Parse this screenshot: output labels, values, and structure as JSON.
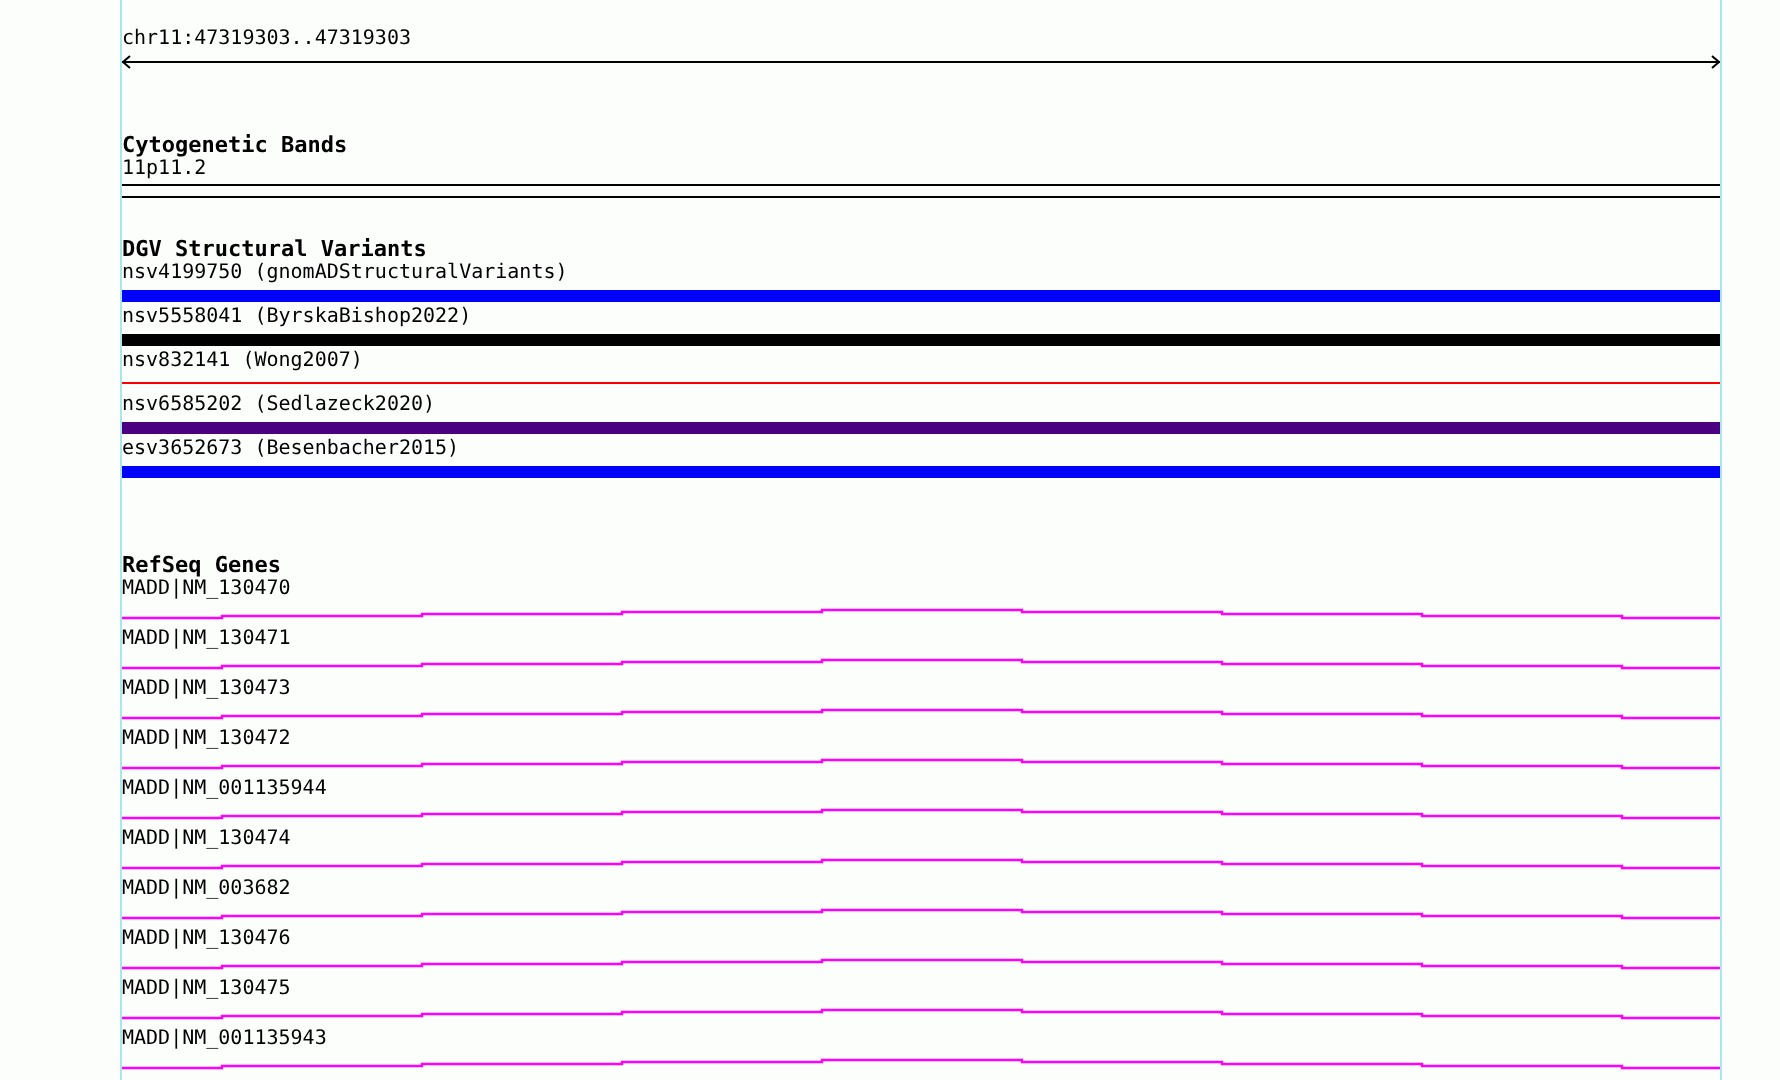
{
  "ruler": {
    "label": "chr11:47319303..47319303"
  },
  "tracks": [
    {
      "kind": "bands",
      "title": "Cytogenetic Bands",
      "features": [
        {
          "label": "11p11.2"
        }
      ]
    },
    {
      "kind": "variants",
      "title": "DGV Structural Variants",
      "features": [
        {
          "label": "nsv4199750 (gnomADStructuralVariants)",
          "color": "#0000ff",
          "kind": "bar"
        },
        {
          "label": "nsv5558041 (ByrskaBishop2022)",
          "color": "#000000",
          "kind": "bar"
        },
        {
          "label": "nsv832141 (Wong2007)",
          "color": "#ff0000",
          "kind": "line"
        },
        {
          "label": "nsv6585202 (Sedlazeck2020)",
          "color": "#4b0082",
          "kind": "bar"
        },
        {
          "label": "esv3652673 (Besenbacher2015)",
          "color": "#0000ff",
          "kind": "bar"
        }
      ]
    },
    {
      "kind": "genes",
      "title": "RefSeq Genes",
      "features": [
        {
          "label": "MADD|NM_130470"
        },
        {
          "label": "MADD|NM_130471"
        },
        {
          "label": "MADD|NM_130473"
        },
        {
          "label": "MADD|NM_130472"
        },
        {
          "label": "MADD|NM_001135944"
        },
        {
          "label": "MADD|NM_130474"
        },
        {
          "label": "MADD|NM_003682"
        },
        {
          "label": "MADD|NM_130476"
        },
        {
          "label": "MADD|NM_130475"
        },
        {
          "label": "MADD|NM_001135943"
        }
      ]
    }
  ]
}
